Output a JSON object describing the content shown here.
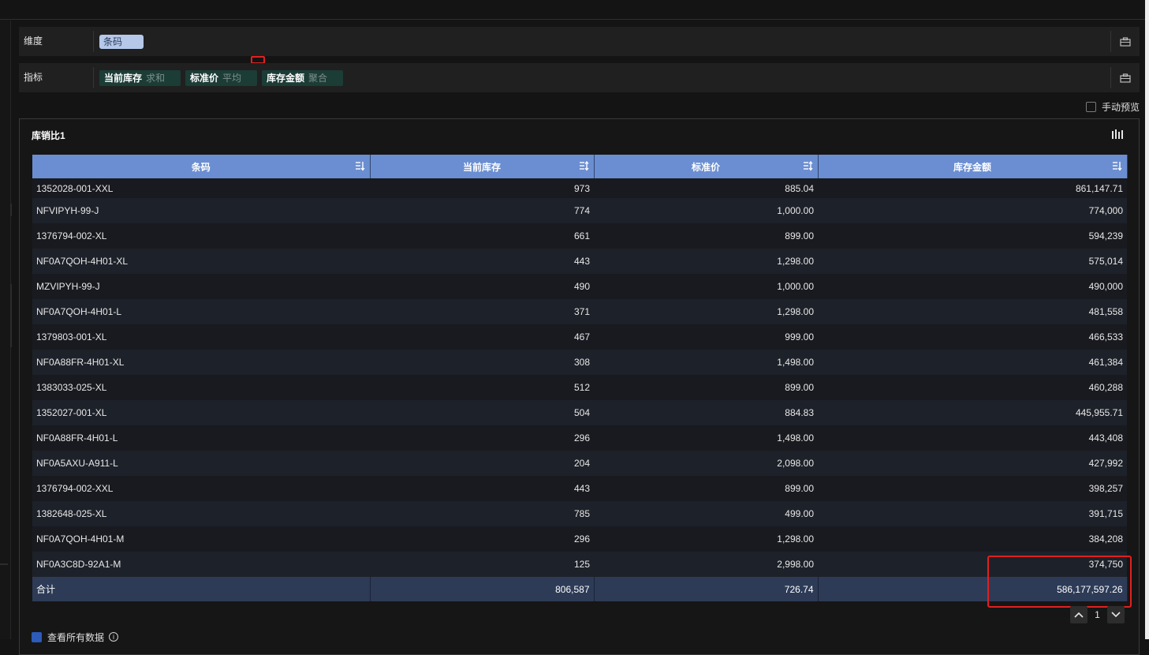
{
  "shelves": {
    "dimension": {
      "label": "维度",
      "pill": "条码"
    },
    "measure": {
      "label": "指标",
      "pills": [
        {
          "name": "当前库存",
          "agg": "求和"
        },
        {
          "name": "标准价",
          "agg": "平均"
        },
        {
          "name": "库存金额",
          "agg": "聚合"
        }
      ]
    }
  },
  "manual_preview": "手动预览",
  "panel": {
    "title": "库销比1"
  },
  "table": {
    "headers": [
      "条码",
      "当前库存",
      "标准价",
      "库存金额"
    ],
    "rows": [
      [
        "1352028-001-XXL",
        "973",
        "885.04",
        "861,147.71"
      ],
      [
        "NFVIPYH-99-J",
        "774",
        "1,000.00",
        "774,000"
      ],
      [
        "1376794-002-XL",
        "661",
        "899.00",
        "594,239"
      ],
      [
        "NF0A7QOH-4H01-XL",
        "443",
        "1,298.00",
        "575,014"
      ],
      [
        "MZVIPYH-99-J",
        "490",
        "1,000.00",
        "490,000"
      ],
      [
        "NF0A7QOH-4H01-L",
        "371",
        "1,298.00",
        "481,558"
      ],
      [
        "1379803-001-XL",
        "467",
        "999.00",
        "466,533"
      ],
      [
        "NF0A88FR-4H01-XL",
        "308",
        "1,498.00",
        "461,384"
      ],
      [
        "1383033-025-XL",
        "512",
        "899.00",
        "460,288"
      ],
      [
        "1352027-001-XL",
        "504",
        "884.83",
        "445,955.71"
      ],
      [
        "NF0A88FR-4H01-L",
        "296",
        "1,498.00",
        "443,408"
      ],
      [
        "NF0A5AXU-A911-L",
        "204",
        "2,098.00",
        "427,992"
      ],
      [
        "1376794-002-XXL",
        "443",
        "899.00",
        "398,257"
      ],
      [
        "1382648-025-XL",
        "785",
        "499.00",
        "391,715"
      ],
      [
        "NF0A7QOH-4H01-M",
        "296",
        "1,298.00",
        "384,208"
      ],
      [
        "NF0A3C8D-92A1-M",
        "125",
        "2,998.00",
        "374,750"
      ]
    ],
    "total": [
      "合计",
      "806,587",
      "726.74",
      "586,177,597.26"
    ]
  },
  "pager": {
    "page": "1"
  },
  "view_all": "查看所有数据"
}
